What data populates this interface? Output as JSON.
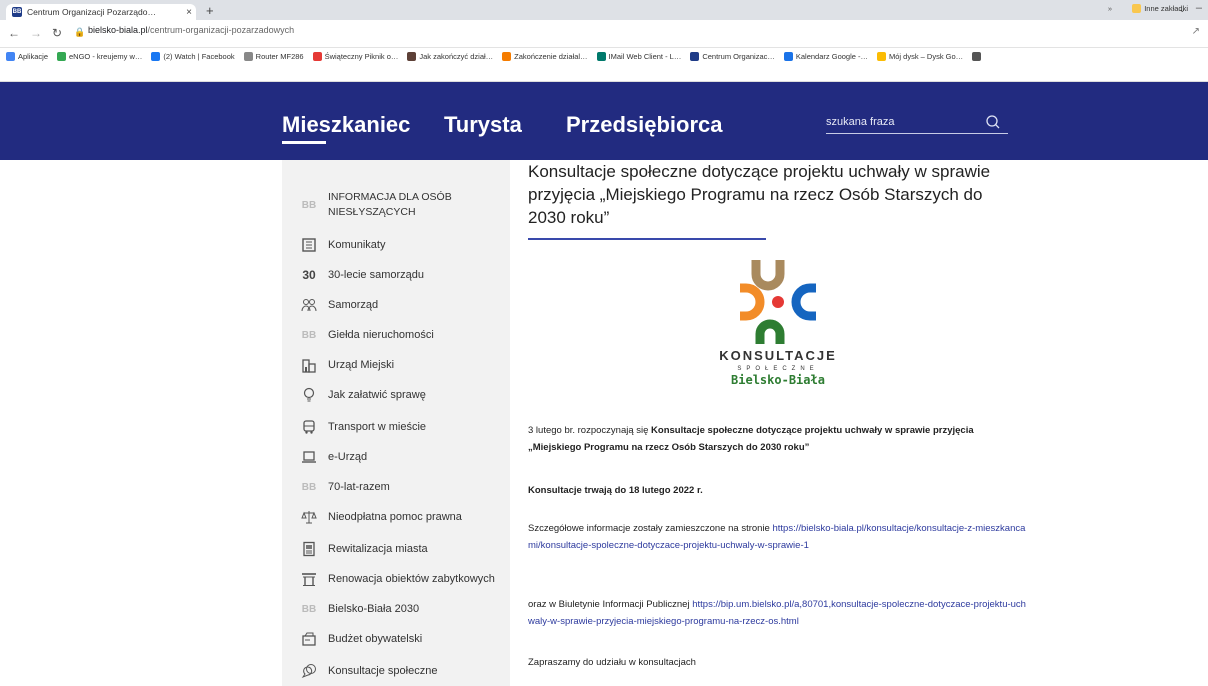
{
  "browser": {
    "tab_title": "Centrum Organizacji Pozarządo…",
    "tab_close": "×",
    "new_tab": "+",
    "url_domain": "bielsko-biala.pl",
    "url_path": "/centrum-organizacji-pozarzadowych",
    "bookmarks": [
      {
        "label": "Aplikacje",
        "color": "#4285f4"
      },
      {
        "label": "eNGO - kreujemy w…",
        "color": "#34a853"
      },
      {
        "label": "(2) Watch | Facebook",
        "color": "#1877f2"
      },
      {
        "label": "Router MF286",
        "color": "#888888"
      },
      {
        "label": "Świąteczny Piknik o…",
        "color": "#e53935"
      },
      {
        "label": "Jak zakończyć dział…",
        "color": "#5d4037"
      },
      {
        "label": "Zakończenie działal…",
        "color": "#f57c00"
      },
      {
        "label": "IMail Web Client - L…",
        "color": "#00796b"
      },
      {
        "label": "Centrum Organizac…",
        "color": "#1f3c88"
      },
      {
        "label": "Kalendarz Google -…",
        "color": "#1a73e8"
      },
      {
        "label": "Mój dysk – Dysk Go…",
        "color": "#fbbc04"
      },
      {
        "label": "",
        "color": "#555555"
      }
    ],
    "bookmarks_more": "»",
    "bookmarks_other": "Inne zakładki"
  },
  "header": {
    "nav": [
      "Mieszkaniec",
      "Turysta",
      "Przedsiębiorca"
    ],
    "search_placeholder": "szukana fraza",
    "bg_color": "#222b80"
  },
  "sidebar": {
    "items": [
      {
        "label": "INFORMACJA DLA OSÓB NIESŁYSZĄCYCH",
        "icon": "bb-logo-icon"
      },
      {
        "label": "Komunikaty",
        "icon": "newspaper-icon"
      },
      {
        "label": "30-lecie samorządu",
        "icon": "thirty-icon"
      },
      {
        "label": "Samorząd",
        "icon": "people-icon"
      },
      {
        "label": "Giełda nieruchomości",
        "icon": "bb-logo-icon"
      },
      {
        "label": "Urząd Miejski",
        "icon": "building-icon"
      },
      {
        "label": "Jak załatwić sprawę",
        "icon": "lightbulb-icon"
      },
      {
        "label": "Transport w mieście",
        "icon": "bus-icon"
      },
      {
        "label": "e-Urząd",
        "icon": "laptop-icon"
      },
      {
        "label": "70-lat-razem",
        "icon": "bb-logo-icon"
      },
      {
        "label": "Nieodpłatna pomoc prawna",
        "icon": "scales-icon"
      },
      {
        "label": "Rewitalizacja miasta",
        "icon": "document-icon"
      },
      {
        "label": "Renowacja obiektów zabytkowych",
        "icon": "monument-icon"
      },
      {
        "label": "Bielsko-Biała 2030",
        "icon": "bb-logo-icon"
      },
      {
        "label": "Budżet obywatelski",
        "icon": "wallet-icon"
      },
      {
        "label": "Konsultacje społeczne",
        "icon": "chat-icon"
      }
    ],
    "thirty_glyph": "30",
    "bb_glyph": "BB"
  },
  "article": {
    "title": "Konsultacje społeczne dotyczące projektu uchwały w sprawie przyjęcia „Miejskiego Programu na rzecz Osób Starszych do 2030 roku”",
    "logo_word": "KONSULTACJE",
    "logo_sub": "SPOŁECZNE",
    "logo_city": "Bielsko-Biała",
    "p1_pre": "3 lutego br. rozpoczynają się ",
    "p1_bold": "Konsultacje społeczne dotyczące projektu uchwały w sprawie przyjęcia „Miejskiego Programu na rzecz Osób Starszych do 2030 roku”",
    "p2": "Konsultacje trwają do 18 lutego 2022 r.",
    "p3_pre": "Szczegółowe informacje zostały zamieszczone na stronie ",
    "p3_link": "https://bielsko-biala.pl/konsultacje/konsultacje-z-mieszkancami/konsultacje-spoleczne-dotyczace-projektu-uchwaly-w-sprawie-1",
    "p4_pre": "oraz w Biuletynie Informacji Publicznej ",
    "p4_link": "https://bip.um.bielsko.pl/a,80701,konsultacje-spoleczne-dotyczace-projektu-uchwaly-w-sprawie-przyjecia-miejskiego-programu-na-rzecz-os.html",
    "p5": "Zapraszamy do udziału w konsultacjach"
  }
}
